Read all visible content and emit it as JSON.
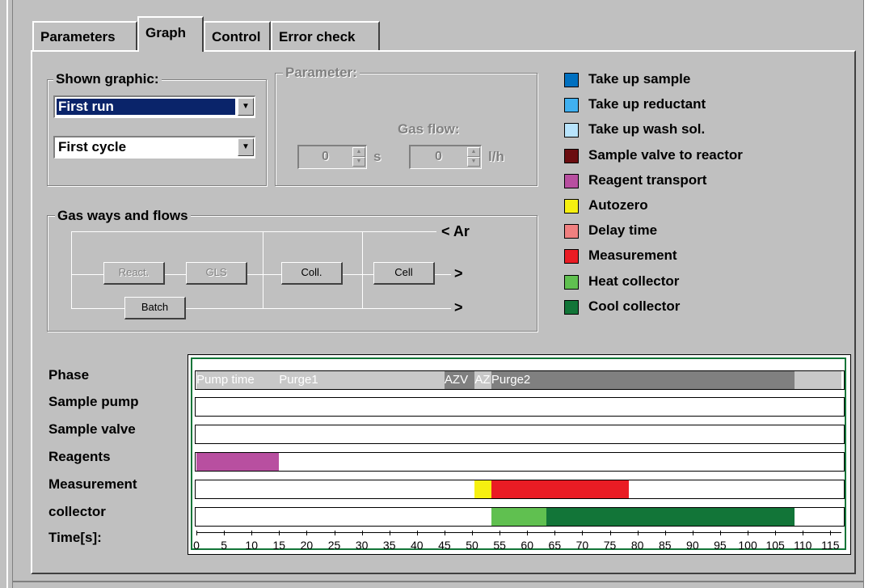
{
  "tabs": [
    "Parameters",
    "Graph",
    "Control",
    "Error check"
  ],
  "active_tab": "Graph",
  "shown_graphic": {
    "title": "Shown graphic:",
    "run_select": "First run",
    "cycle_select": "First cycle"
  },
  "parameter": {
    "title": "Parameter:",
    "gas_flow_label": "Gas flow:",
    "time_value": "0",
    "time_unit": "s",
    "flow_value": "0",
    "flow_unit": "l/h"
  },
  "gas_ways": {
    "title": "Gas ways and flows",
    "react": "React.",
    "gls": "GLS",
    "coll": "Coll.",
    "cell": "Cell",
    "batch": "Batch",
    "ar": "< Ar",
    "arrow": ">"
  },
  "legend": [
    {
      "label": "Take up sample",
      "color": "#0070c0"
    },
    {
      "label": "Take up reductant",
      "color": "#40b0f0"
    },
    {
      "label": "Take up wash sol.",
      "color": "#b8e4fc"
    },
    {
      "label": "Sample valve to reactor",
      "color": "#6b0d10"
    },
    {
      "label": "Reagent transport",
      "color": "#b84fa0"
    },
    {
      "label": "Autozero",
      "color": "#f6f010"
    },
    {
      "label": "Delay time",
      "color": "#f08080"
    },
    {
      "label": "Measurement",
      "color": "#ea1c24"
    },
    {
      "label": "Heat collector",
      "color": "#60c050"
    },
    {
      "label": "Cool collector",
      "color": "#127538"
    }
  ],
  "row_labels": [
    "Phase",
    "Sample pump",
    "Sample valve",
    "Reagents",
    "Measurement",
    "collector",
    "Time[s]:"
  ],
  "chart_data": {
    "type": "gantt",
    "x_range": [
      0,
      117
    ],
    "x_ticks": [
      0,
      5,
      10,
      15,
      20,
      25,
      30,
      35,
      40,
      45,
      50,
      55,
      60,
      65,
      70,
      75,
      80,
      85,
      90,
      95,
      100,
      105,
      110,
      115
    ],
    "phase_segments": [
      {
        "label": "Pump time",
        "start": 0,
        "end": 15,
        "color": "#c8c8c8"
      },
      {
        "label": "Purge1",
        "start": 15,
        "end": 45,
        "color": "#c8c8c8"
      },
      {
        "label": "AZV",
        "start": 45,
        "end": 50.5,
        "color": "#808080"
      },
      {
        "label": "AZ",
        "start": 50.5,
        "end": 53.5,
        "color": "#c8c8c8"
      },
      {
        "label": "Purge2",
        "start": 53.5,
        "end": 108.5,
        "color": "#808080"
      },
      {
        "label": "",
        "start": 108.5,
        "end": 117,
        "color": "#c8c8c8"
      }
    ],
    "rows": [
      {
        "name": "Sample pump",
        "segments": []
      },
      {
        "name": "Sample valve",
        "segments": []
      },
      {
        "name": "Reagents",
        "segments": [
          {
            "start": 0,
            "end": 15,
            "color": "#b84fa0"
          }
        ]
      },
      {
        "name": "Measurement",
        "segments": [
          {
            "start": 50.5,
            "end": 53.5,
            "color": "#f6f010"
          },
          {
            "start": 53.5,
            "end": 78.5,
            "color": "#ea1c24"
          }
        ]
      },
      {
        "name": "collector",
        "segments": [
          {
            "start": 53.5,
            "end": 63.5,
            "color": "#60c050"
          },
          {
            "start": 63.5,
            "end": 108.5,
            "color": "#127538"
          }
        ]
      }
    ]
  }
}
